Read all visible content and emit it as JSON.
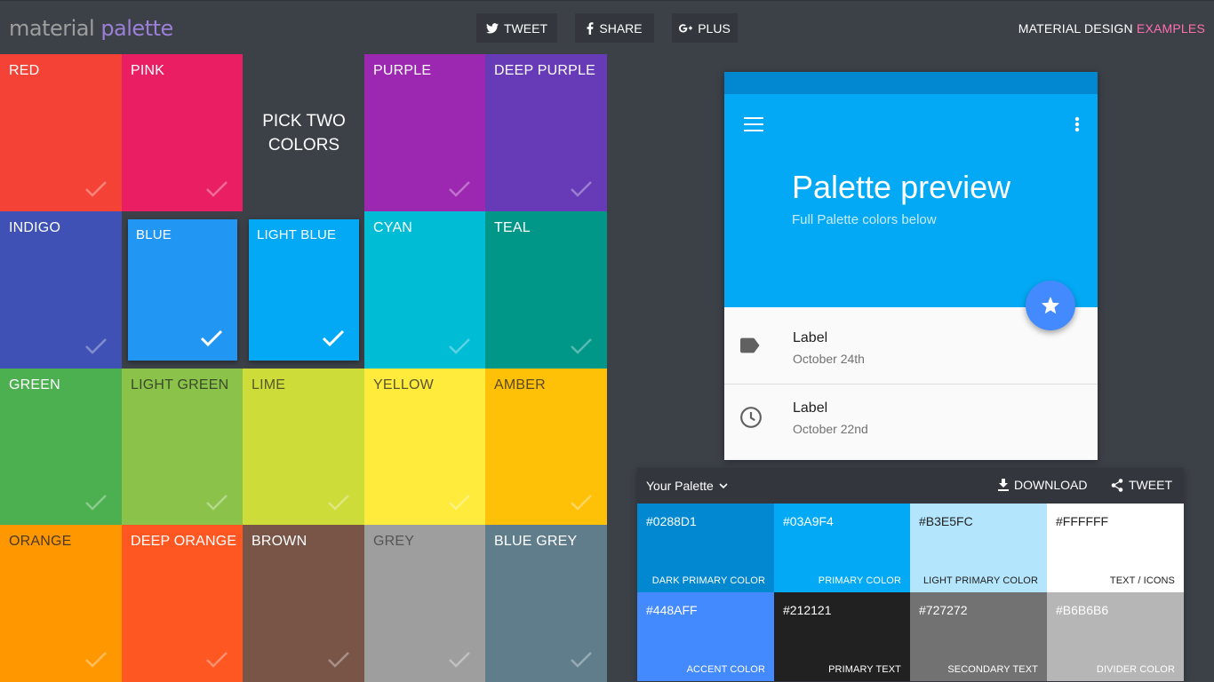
{
  "header": {
    "logo_part1": "material",
    "logo_part2": "palette",
    "tweet_label": "TWEET",
    "share_label": "SHARE",
    "plus_label": "PLUS",
    "link_part1": "MATERIAL DESIGN",
    "link_part2": "EXAMPLES"
  },
  "grid": {
    "pick_line1": "PICK TWO",
    "pick_line2": "COLORS",
    "tiles": [
      {
        "name": "RED",
        "color": "#f44336",
        "text_color": "#ffffff",
        "selected": false
      },
      {
        "name": "PINK",
        "color": "#e91e63",
        "text_color": "#ffffff",
        "selected": false
      },
      {
        "name": "PURPLE",
        "color": "#9c27b0",
        "text_color": "#ffffff",
        "selected": false
      },
      {
        "name": "DEEP PURPLE",
        "color": "#673ab7",
        "text_color": "#ffffff",
        "selected": false
      },
      {
        "name": "INDIGO",
        "color": "#3f51b5",
        "text_color": "#ffffff",
        "selected": false
      },
      {
        "name": "BLUE",
        "color": "#2196f3",
        "text_color": "#ffffff",
        "selected": true
      },
      {
        "name": "LIGHT BLUE",
        "color": "#03a9f4",
        "text_color": "#ffffff",
        "selected": true
      },
      {
        "name": "CYAN",
        "color": "#00bcd4",
        "text_color": "#ffffff",
        "selected": false
      },
      {
        "name": "TEAL",
        "color": "#009688",
        "text_color": "#ffffff",
        "selected": false
      },
      {
        "name": "GREEN",
        "color": "#4caf50",
        "text_color": "#ffffff",
        "selected": false
      },
      {
        "name": "LIGHT GREEN",
        "color": "#8bc34a",
        "text_color": "#3a4a2a",
        "selected": false
      },
      {
        "name": "LIME",
        "color": "#cddc39",
        "text_color": "#555a2a",
        "selected": false
      },
      {
        "name": "YELLOW",
        "color": "#ffeb3b",
        "text_color": "#5a5530",
        "selected": false
      },
      {
        "name": "AMBER",
        "color": "#ffc107",
        "text_color": "#5a4a20",
        "selected": false
      },
      {
        "name": "ORANGE",
        "color": "#ff9800",
        "text_color": "#4a3a20",
        "selected": false
      },
      {
        "name": "DEEP ORANGE",
        "color": "#ff5722",
        "text_color": "#ffffff",
        "selected": false
      },
      {
        "name": "BROWN",
        "color": "#795548",
        "text_color": "#ffffff",
        "selected": false
      },
      {
        "name": "GREY",
        "color": "#9e9e9e",
        "text_color": "#555555",
        "selected": false
      },
      {
        "name": "BLUE GREY",
        "color": "#607d8b",
        "text_color": "#ffffff",
        "selected": false
      }
    ]
  },
  "preview": {
    "title": "Palette preview",
    "subtitle": "Full Palette colors below",
    "items": [
      {
        "label": "Label",
        "date": "October 24th",
        "icon": "label-icon"
      },
      {
        "label": "Label",
        "date": "October 22nd",
        "icon": "clock-icon"
      }
    ]
  },
  "palette": {
    "title": "Your Palette",
    "download_label": "DOWNLOAD",
    "tweet_label": "TWEET",
    "swatches": [
      {
        "hex": "#0288D1",
        "name": "DARK PRIMARY COLOR",
        "bg": "#0288d1",
        "fg": "#ffffff"
      },
      {
        "hex": "#03A9F4",
        "name": "PRIMARY COLOR",
        "bg": "#03a9f4",
        "fg": "#ffffff"
      },
      {
        "hex": "#B3E5FC",
        "name": "LIGHT PRIMARY COLOR",
        "bg": "#b3e5fc",
        "fg": "#212121"
      },
      {
        "hex": "#FFFFFF",
        "name": "TEXT / ICONS",
        "bg": "#ffffff",
        "fg": "#212121"
      },
      {
        "hex": "#448AFF",
        "name": "ACCENT COLOR",
        "bg": "#448aff",
        "fg": "#ffffff"
      },
      {
        "hex": "#212121",
        "name": "PRIMARY TEXT",
        "bg": "#212121",
        "fg": "#ffffff"
      },
      {
        "hex": "#727272",
        "name": "SECONDARY TEXT",
        "bg": "#727272",
        "fg": "#ffffff"
      },
      {
        "hex": "#B6B6B6",
        "name": "DIVIDER COLOR",
        "bg": "#b6b6b6",
        "fg": "#ffffff"
      }
    ]
  }
}
